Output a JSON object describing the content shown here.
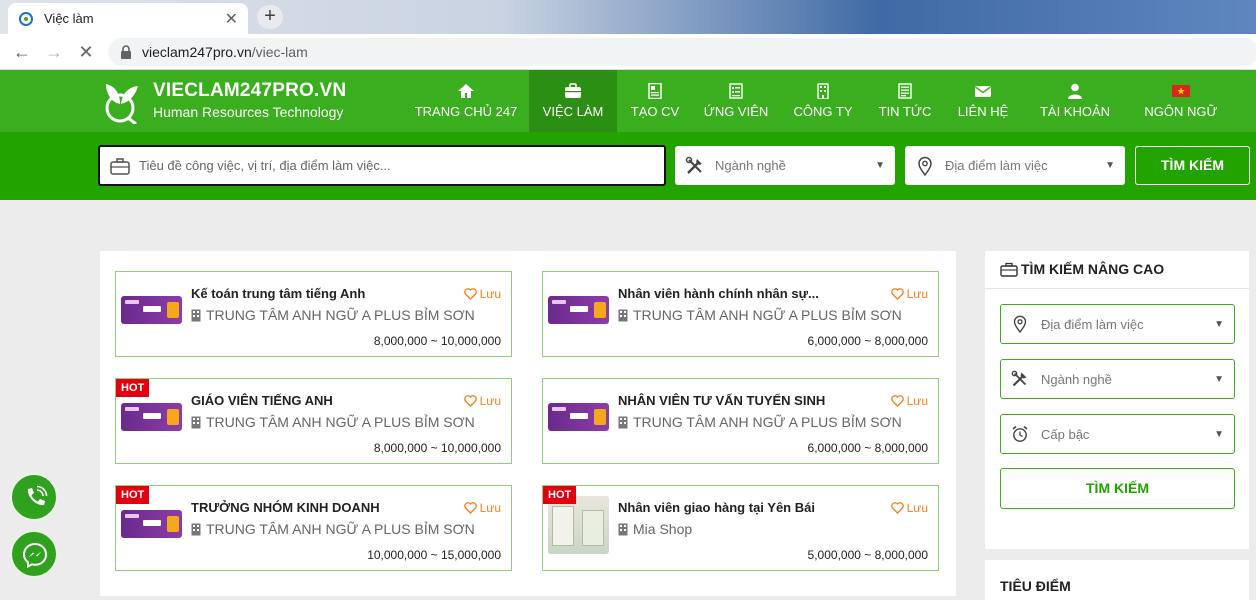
{
  "browser": {
    "tab_title": "Việc làm",
    "url_host": "vieclam247pro.vn",
    "url_path": "/viec-lam"
  },
  "site": {
    "brand_name": "VIECLAM247PRO.VN",
    "brand_tagline": "Human Resources Technology",
    "nav": [
      {
        "label": "TRANG CHỦ 247",
        "icon": "home-icon"
      },
      {
        "label": "VIỆC LÀM",
        "icon": "briefcase-icon",
        "active": true
      },
      {
        "label": "TẠO CV",
        "icon": "cv-icon"
      },
      {
        "label": "ỨNG VIÊN",
        "icon": "candidate-icon"
      },
      {
        "label": "CÔNG TY",
        "icon": "building-icon"
      },
      {
        "label": "TIN TỨC",
        "icon": "news-icon"
      },
      {
        "label": "LIÊN HỆ",
        "icon": "envelope-icon"
      },
      {
        "label": "TÀI KHOẢN",
        "icon": "user-icon"
      },
      {
        "label": "NGÔN NGỮ",
        "icon": "vietnam-flag-icon"
      }
    ]
  },
  "search": {
    "keyword_placeholder": "Tiêu đề công việc, vị trí, địa điểm làm việc...",
    "industry_placeholder": "Ngành nghề",
    "location_placeholder": "Địa điểm làm việc",
    "button_label": "TÌM KIẾM"
  },
  "jobs": [
    {
      "title": "Kế toán trung tâm tiếng Anh",
      "company": "TRUNG TÂM ANH NGỮ A PLUS BỈM SƠN",
      "salary": "8,000,000 ~ 10,000,000",
      "save": "Lưu",
      "hot": ""
    },
    {
      "title": "Nhân viên hành chính nhân sự...",
      "company": "TRUNG TÂM ANH NGỮ A PLUS BỈM SƠN",
      "salary": "6,000,000 ~ 8,000,000",
      "save": "Lưu",
      "hot": ""
    },
    {
      "title": "GIÁO VIÊN TIẾNG ANH",
      "company": "TRUNG TÂM ANH NGỮ A PLUS BỈM SƠN",
      "salary": "8,000,000 ~ 10,000,000",
      "save": "Lưu",
      "hot": "HOT"
    },
    {
      "title": "NHÂN VIÊN TƯ VẤN TUYỂN SINH",
      "company": "TRUNG TÂM ANH NGỮ A PLUS BỈM SƠN",
      "salary": "6,000,000 ~ 8,000,000",
      "save": "Lưu",
      "hot": ""
    },
    {
      "title": "TRƯỞNG NHÓM KINH DOANH",
      "company": "TRUNG TÂM ANH NGỮ A PLUS BỈM SƠN",
      "salary": "10,000,000 ~ 15,000,000",
      "save": "Lưu",
      "hot": "HOT"
    },
    {
      "title": "Nhân viên giao hàng tại Yên Bái",
      "company": "Mia Shop",
      "salary": "5,000,000 ~ 8,000,000",
      "save": "Lưu",
      "hot": "HOT"
    }
  ],
  "sidebar": {
    "advanced_title": "TÌM KIẾM NÂNG CAO",
    "location_placeholder": "Địa điểm làm việc",
    "industry_placeholder": "Ngành nghề",
    "level_placeholder": "Cấp bậc",
    "button_label": "TÌM KIẾM",
    "focus_title": "TIÊU ĐIỂM"
  },
  "colors": {
    "header_green": "#3aae1e",
    "search_green": "#22a300",
    "hot_red": "#e3000f",
    "save_orange": "#f58220"
  }
}
